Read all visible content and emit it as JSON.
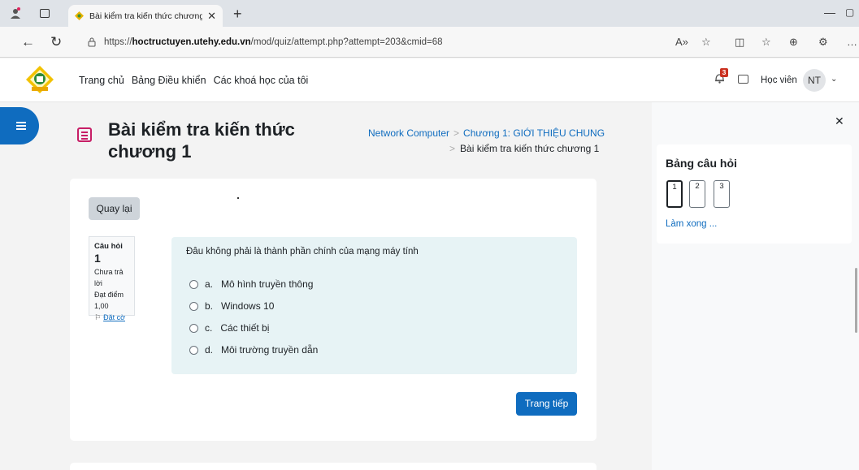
{
  "browser": {
    "tab_title": "Bài kiểm tra kiến thức chương 1 |",
    "url_prefix": "https://",
    "url_host": "hoctructuyen.utehy.edu.vn",
    "url_path": "/mod/quiz/attempt.php?attempt=203&cmid=68"
  },
  "header": {
    "nav": [
      "Trang chủ",
      "Bảng Điều khiển",
      "Các khoá học của tôi"
    ],
    "notification_count": "3",
    "role": "Học viên",
    "avatar_initials": "NT"
  },
  "page": {
    "title": "Bài kiểm tra kiến thức chương 1",
    "breadcrumb": [
      "Network Computer",
      "Chương 1: GIỚI THIỆU CHUNG",
      "Bài kiểm tra kiến thức chương 1"
    ]
  },
  "quiz": {
    "back_label": "Quay lại",
    "question_label": "Câu hỏi",
    "question_number": "1",
    "status": "Chưa trả lời",
    "points": "Đạt điểm 1,00",
    "flag_label": "Đặt cờ",
    "question_text": "Đâu không phải là thành phần chính của mạng máy tính",
    "options": [
      {
        "letter": "a.",
        "text": "Mô hình truyền thông"
      },
      {
        "letter": "b.",
        "text": "Windows 10"
      },
      {
        "letter": "c.",
        "text": "Các thiết bị"
      },
      {
        "letter": "d.",
        "text": "Môi trường truyền dẫn"
      }
    ],
    "next_label": "Trang tiếp"
  },
  "navigation": {
    "title": "Bảng câu hỏi",
    "questions": [
      "1",
      "2",
      "3"
    ],
    "finish_label": "Làm xong ..."
  },
  "colors": {
    "primary": "#0f6cbf",
    "question_bg": "#e7f3f5",
    "page_icon": "#c71e66",
    "badge": "#ca3120"
  }
}
